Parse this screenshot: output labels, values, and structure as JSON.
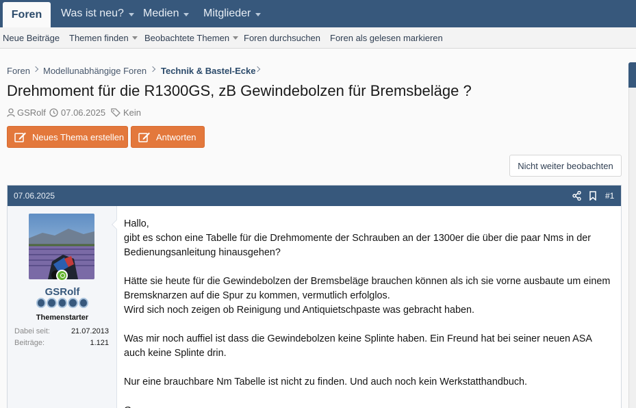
{
  "nav": {
    "tabs": [
      {
        "label": "Foren",
        "active": true
      },
      {
        "label": "Was ist neu?"
      },
      {
        "label": "Medien"
      },
      {
        "label": "Mitglieder"
      }
    ],
    "sub": [
      {
        "label": "Neue Beiträge"
      },
      {
        "label": "Themen finden"
      },
      {
        "label": "Beobachtete Themen"
      },
      {
        "label": "Foren durchsuchen"
      },
      {
        "label": "Foren als gelesen markieren"
      }
    ]
  },
  "breadcrumb": [
    "Foren",
    "Modellunabhängige Foren",
    "Technik & Bastel-Ecke"
  ],
  "thread": {
    "title": "Drehmoment für die R1300GS, zB Gewindebolzen für Bremsbeläge ?",
    "author": "GSRolf",
    "date": "07.06.2025",
    "tags": "Kein"
  },
  "buttons": {
    "new_thread": "Neues Thema erstellen",
    "reply": "Antworten",
    "unwatch": "Nicht weiter beobachten"
  },
  "post": {
    "date": "07.06.2025",
    "number": "#1",
    "user": {
      "name": "GSRolf",
      "title": "Themenstarter",
      "joined_label": "Dabei seit:",
      "joined": "21.07.2013",
      "posts_label": "Beiträge:",
      "posts": "1.121"
    },
    "lines": [
      "Hallo,",
      "gibt es schon eine Tabelle für die Drehmomente der Schrauben an der 1300er die über die paar Nms in der Bedienungsanleitung hinausgehen?",
      "Hätte sie heute für die Gewindebolzen der Bremsbeläge brauchen können als ich sie vorne ausbaute um einem Bremsknarzen auf die Spur zu kommen, vermutlich erfolglos.",
      "Wird sich noch zeigen ob Reinigung und Antiquietschpaste was gebracht haben.",
      "Was mir noch auffiel ist dass die Gewindebolzen keine Splinte haben. Ein Freund hat bei seiner neuen ASA auch keine Splinte drin.",
      "Nur eine brauchbare Nm Tabelle ist nicht zu finden. Und auch noch kein Werkstatthandbuch.",
      "G"
    ]
  },
  "colors": {
    "nav": "#37587c",
    "accent": "#e3783c",
    "online": "#63b42f"
  }
}
